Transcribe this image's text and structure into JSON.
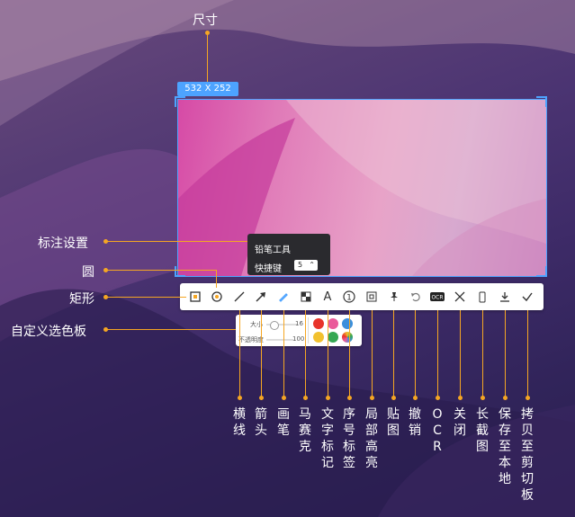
{
  "size_label": "尺寸",
  "size_badge": "532 X 252",
  "tooltip": {
    "title": "铅笔工具",
    "shortcut_label": "快捷键",
    "shortcut_value": "5"
  },
  "palette": {
    "size_label": "大小",
    "size_value": "16",
    "opacity_label": "不透明度",
    "opacity_value": "100"
  },
  "left_labels": {
    "annotation_settings": "标注设置",
    "circle": "圆",
    "rectangle": "矩形",
    "custom_palette": "自定义选色板"
  },
  "tool_labels": [
    "横线",
    "箭头",
    "画笔",
    "马赛克",
    "文字标记",
    "序号标签",
    "局部高亮",
    "贴图",
    "撤销",
    "OCR",
    "关闭",
    "长截图",
    "保存至本地",
    "拷贝至剪切板"
  ],
  "icons": [
    "rectangle-icon",
    "circle-icon",
    "line-icon",
    "arrow-icon",
    "pencil-icon",
    "mosaic-icon",
    "text-icon",
    "number-icon",
    "highlight-icon",
    "pin-icon",
    "undo-icon",
    "ocr-icon",
    "close-icon",
    "long-screenshot-icon",
    "download-icon",
    "check-icon"
  ],
  "colors": {
    "accent": "#f5a623",
    "selection": "#4da3ff"
  }
}
